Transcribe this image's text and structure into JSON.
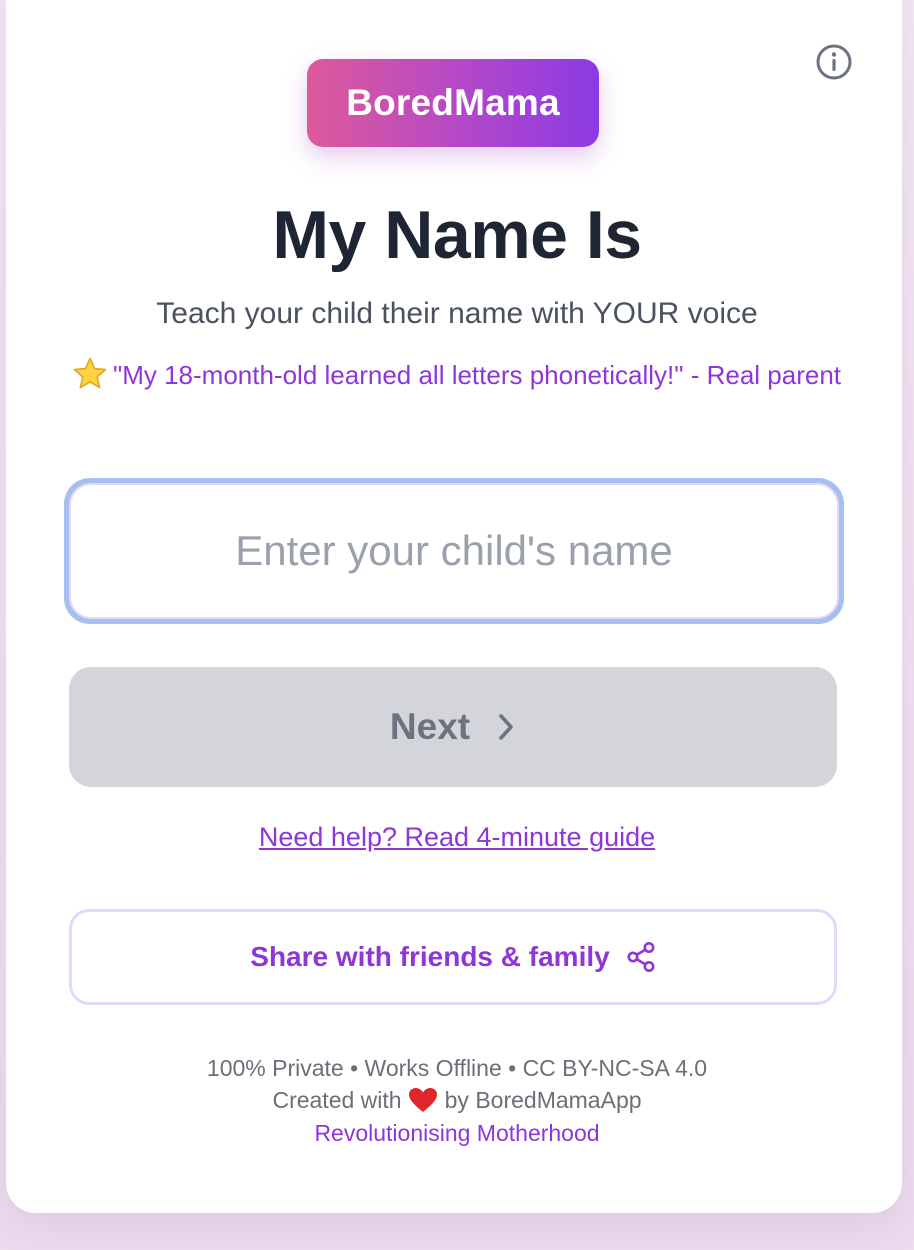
{
  "app": {
    "logo_text": "BoredMama"
  },
  "header": {
    "title": "My Name Is",
    "subtitle": "Teach your child their name with YOUR voice",
    "testimonial": "\"My 18-month-old learned all letters phonetically!\" - Real parent"
  },
  "form": {
    "name_placeholder": "Enter your child's name",
    "name_value": "",
    "next_label": "Next"
  },
  "links": {
    "guide": "Need help? Read 4-minute guide"
  },
  "share": {
    "label": "Share with friends & family"
  },
  "footer": {
    "line1": "100% Private • Works Offline • CC BY-NC-SA 4.0",
    "line2_prefix": "Created with",
    "line2_suffix": "by BoredMamaApp",
    "tagline": "Revolutionising Motherhood"
  },
  "icons": {
    "info": "info-icon",
    "star": "star-icon",
    "next": "chevron-right-icon",
    "share": "share-icon",
    "heart": "heart-icon"
  },
  "colors": {
    "accent": "#8e36d8",
    "logo_gradient_start": "#dd5a9a",
    "logo_gradient_end": "#8b3ae4",
    "title": "#1e2533",
    "button_disabled": "#d3d5da",
    "input_focus_ring": "#a5bff0",
    "heart": "#e0252b"
  }
}
